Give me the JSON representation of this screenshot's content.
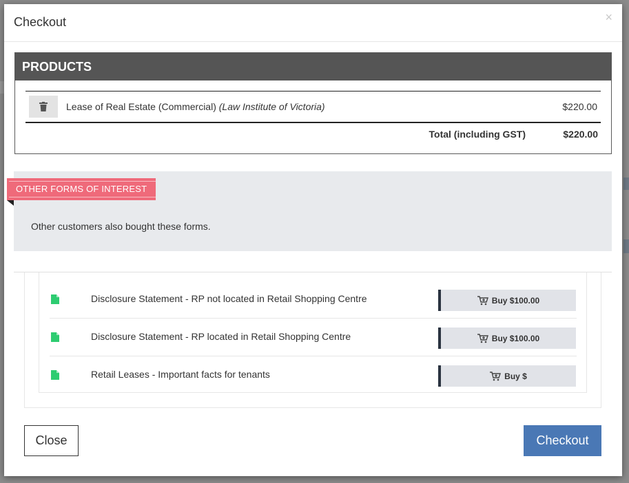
{
  "modal": {
    "title": "Checkout",
    "close_symbol": "×"
  },
  "products": {
    "heading": "PRODUCTS",
    "items": [
      {
        "name": "Lease of Real Estate (Commercial)",
        "publisher": "(Law Institute of Victoria)",
        "price": "$220.00",
        "icon": "trash-icon"
      }
    ],
    "total_label": "Total (including GST)",
    "total_value": "$220.00"
  },
  "interest": {
    "ribbon": "OTHER FORMS OF INTEREST",
    "text": "Other customers also bought these forms."
  },
  "forms": [
    {
      "name": "Disclosure Statement - RP not located in Retail Shopping Centre",
      "buy_label": "Buy $100.00",
      "icon": "document-icon"
    },
    {
      "name": "Disclosure Statement - RP located in Retail Shopping Centre",
      "buy_label": "Buy $100.00",
      "icon": "document-icon"
    },
    {
      "name": "Retail Leases - Important facts for tenants",
      "buy_label": "Buy $",
      "icon": "document-icon"
    }
  ],
  "footer": {
    "close_label": "Close",
    "checkout_label": "Checkout"
  },
  "colors": {
    "ribbon": "#ef6a7a",
    "checkout": "#4a78b5",
    "doc_icon": "#2ecc71",
    "header_bar": "#555555"
  }
}
